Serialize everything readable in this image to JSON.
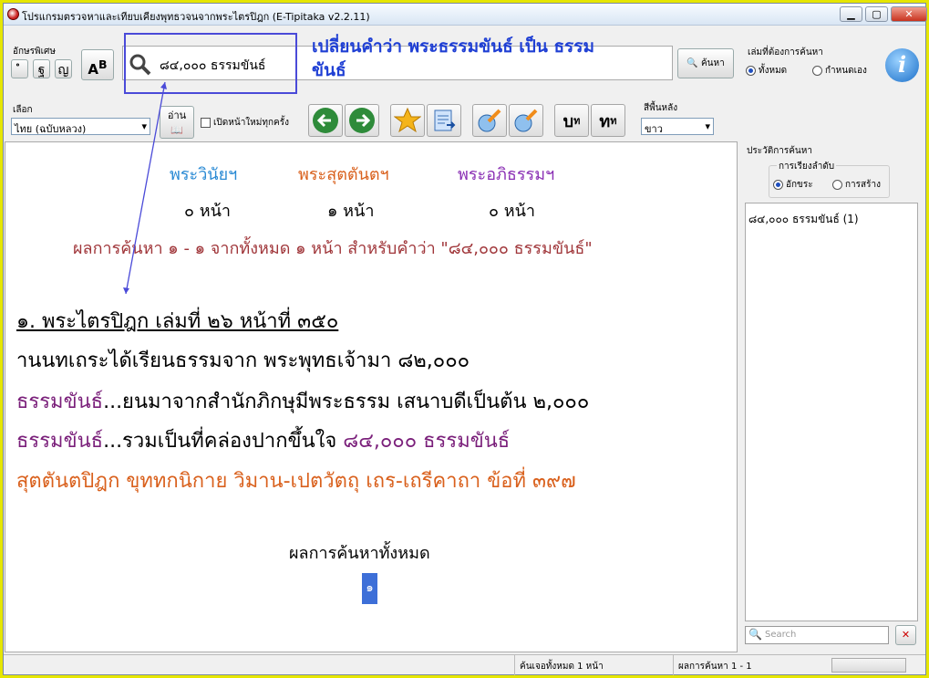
{
  "window": {
    "title": "โปรแกรมตรวจหาและเทียบเคียงพุทธวจนจากพระไตรปิฎก (E-Tipitaka v2.2.11)",
    "min": "▁",
    "max": "▢",
    "close": "✕"
  },
  "toolbar": {
    "special_label": "อักษรพิเศษ",
    "special_keys": [
      "ํ",
      "ฐ",
      "ญ"
    ],
    "search_value": "๘๔,๐๐๐ ธรรมขันธ์",
    "search_button": "ค้นหา",
    "choose_label": "เลือก",
    "lang_value": "ไทย (ฉบับหลวง)",
    "read_button": "อ่าน",
    "new_page_label": "เปิดหน้าใหม่ทุกครั้ง",
    "scope_label": "เล่มที่ต้องการค้นหา",
    "scope_all": "ทั้งหมด",
    "scope_custom": "กำหนดเอง",
    "bg_label": "สีพื้นหลัง",
    "bg_value": "ขาว",
    "btn_b": "บ",
    "btn_t": "ท"
  },
  "annotation": {
    "text": "เปลี่ยนคำว่า พระธรรมขันธ์ เป็น ธรรมขันธ์"
  },
  "results": {
    "cats": [
      {
        "name": "พระวินัยฯ",
        "pages": "๐ หน้า",
        "color": "#2a8ad4"
      },
      {
        "name": "พระสุตตันตฯ",
        "pages": "๑ หน้า",
        "color": "#d9601c"
      },
      {
        "name": "พระอภิธรรมฯ",
        "pages": "๐ หน้า",
        "color": "#8a2fb4"
      }
    ],
    "summary": "ผลการค้นหา ๑ - ๑ จากทั้งหมด ๑ หน้า สำหรับคำว่า \"๘๔,๐๐๐ ธรรมขันธ์\"",
    "heading": "๑. พระไตรปิฎก เล่มที่ ๒๖ หน้าที่ ๓๕๐",
    "line1": "านนทเถระได้เรียนธรรมจาก พระพุทธเจ้ามา ๘๒,๐๐๐",
    "l2a": "ธรรมขันธ์",
    "l2b": "...ยนมาจากสำนักภิกษุมีพระธรรม เสนาบดีเป็นต้น ๒,๐๐๐",
    "l3a": "ธรรมขันธ์",
    "l3b": "...รวมเป็นที่คล่องปากขึ้นใจ ",
    "l3c": "๘๔,๐๐๐ ธรรมขันธ์",
    "line4": "สุตตันตปิฎก ขุททกนิกาย วิมาน-เปตวัตถุ เถร-เถรีคาถา ข้อที่ ๓๙๗",
    "all_label": "ผลการค้นหาทั้งหมด",
    "page_btn": "๑"
  },
  "sidebar": {
    "history_label": "ประวัติการค้นหา",
    "sort_label": "การเรียงลำดับ",
    "sort_alpha": "อักขระ",
    "sort_created": "การสร้าง",
    "history_items": [
      "๘๔,๐๐๐ ธรรมขันธ์ (1)"
    ],
    "search_placeholder": "Search"
  },
  "status": {
    "found": "ค้นเจอทั้งหมด 1 หน้า",
    "range": "ผลการค้นหา 1 - 1"
  }
}
